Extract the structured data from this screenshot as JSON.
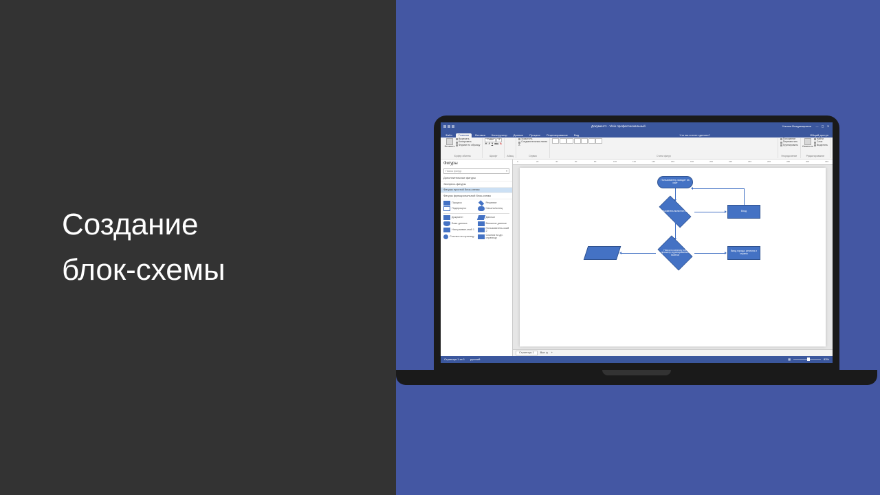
{
  "slide": {
    "title_line1": "Создание",
    "title_line2": "блок-схемы"
  },
  "app": {
    "titlebar": {
      "doc_title": "Документ1 - Visio профессиональный",
      "user": "Ульяна Владимировна",
      "win_min": "—",
      "win_max": "▢",
      "win_close": "✕"
    },
    "tabs": {
      "items": [
        "Файл",
        "Главная",
        "Вставка",
        "Конструктор",
        "Данные",
        "Процесс",
        "Рецензирование",
        "Вид"
      ],
      "tell_me": "Что вы хотите сделать?",
      "share": "Общий доступ"
    },
    "ribbon": {
      "clipboard": {
        "label": "Буфер обмена",
        "paste": "Вставить",
        "cut": "Вырезать",
        "copy": "Копировать",
        "painter": "Формат по образцу"
      },
      "font": {
        "label": "Шрифт",
        "name": "Calibri",
        "size": "8",
        "bold": "Ж",
        "italic": "К",
        "underline": "Ч",
        "strike": "abc",
        "color": "A"
      },
      "paragraph": {
        "label": "Абзац"
      },
      "tools": {
        "label": "Сервис",
        "pointer": "Указатель",
        "connector": "Соединительная линия",
        "text": "A"
      },
      "shape_styles": {
        "label": "Стили фигур"
      },
      "arrange": {
        "label": "Упорядочение",
        "align": "Положение",
        "bring": "Переместить",
        "group": "Группировать"
      },
      "edit": {
        "label": "Редактирование",
        "change": "Изменить",
        "find": "Найти",
        "select": "Выделить",
        "layers": "Слои"
      }
    },
    "shapes_pane": {
      "title": "Фигуры",
      "search_placeholder": "Поиск фигур",
      "more": "Дополнительные фигуры",
      "quick": "Экспресс-фигуры",
      "stencils": [
        "Фигуры простой блок-схемы",
        "Фигуры функциональной блок-схемы"
      ],
      "items": [
        {
          "name": "Процесс"
        },
        {
          "name": "Решение"
        },
        {
          "name": "Подпроцесс"
        },
        {
          "name": "Начало/конец"
        },
        {
          "name": "Документ"
        },
        {
          "name": "Данные"
        },
        {
          "name": "База данных"
        },
        {
          "name": "Внешние данные"
        },
        {
          "name": "Настраивае-мый 1"
        },
        {
          "name": "Пользователь-ский 2"
        },
        {
          "name": "Ссылка на страницу"
        },
        {
          "name": "Ссылка на др. страницу"
        }
      ]
    },
    "flowchart": {
      "n1": "Пользователь заходит на сайт",
      "n2": "Пользователь выполнил вход?",
      "n3": "Вход",
      "n4": "Поиск по каталогу или просмотр сгруппированных билетов",
      "n5": "",
      "n6": "Ввод города, региона и страны"
    },
    "pagetabs": {
      "page": "Страница-1",
      "all": "Все ▲",
      "add": "+"
    },
    "status": {
      "left": "Страница 1 из 1",
      "lang": "русский",
      "zoom": "83%"
    },
    "ruler_ticks": [
      "0",
      "20",
      "40",
      "60",
      "80",
      "100",
      "120",
      "140",
      "160",
      "180",
      "200",
      "220",
      "240",
      "260",
      "280",
      "300",
      "320"
    ]
  }
}
